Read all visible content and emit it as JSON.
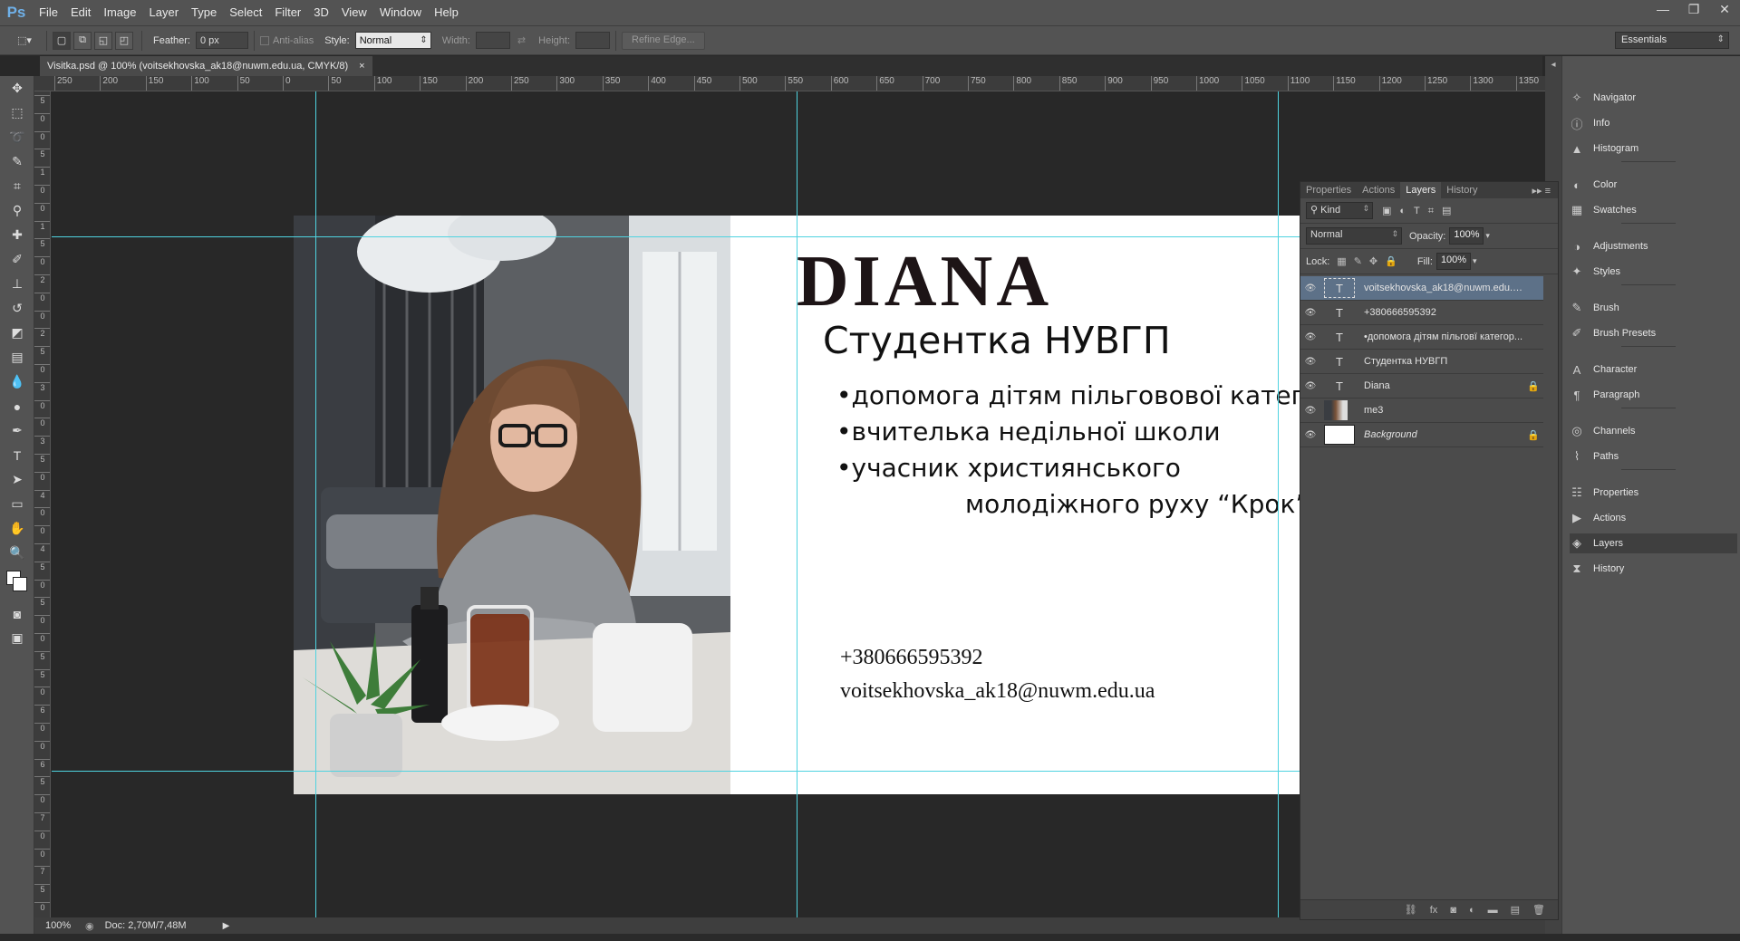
{
  "app": {
    "logo": "Ps"
  },
  "menu": [
    "File",
    "Edit",
    "Image",
    "Layer",
    "Type",
    "Select",
    "Filter",
    "3D",
    "View",
    "Window",
    "Help"
  ],
  "window_controls": [
    "—",
    "❐",
    "✕"
  ],
  "options": {
    "feather_label": "Feather:",
    "feather_value": "0 px",
    "antialias_label": "Anti-alias",
    "style_label": "Style:",
    "style_value": "Normal",
    "width_label": "Width:",
    "height_label": "Height:",
    "refine_edge": "Refine Edge...",
    "workspace": "Essentials"
  },
  "document_tab": {
    "title": "Visitka.psd @ 100% (voitsekhovska_ak18@nuwm.edu.ua, CMYK/8)",
    "close": "×"
  },
  "ruler_h": [
    "250",
    "200",
    "150",
    "100",
    "50",
    "0",
    "50",
    "100",
    "150",
    "200",
    "250",
    "300",
    "350",
    "400",
    "450",
    "500",
    "550",
    "600",
    "650",
    "700",
    "750",
    "800",
    "850",
    "900",
    "950",
    "1000",
    "1050",
    "1100",
    "1150",
    "1200",
    "1250",
    "1300",
    "1350"
  ],
  "ruler_v": [
    "5",
    "0",
    "0",
    "5",
    "1",
    "0",
    "0",
    "1",
    "5",
    "0",
    "2",
    "0",
    "0",
    "2",
    "5",
    "0",
    "3",
    "0",
    "0",
    "3",
    "5",
    "0",
    "4",
    "0",
    "0",
    "4",
    "5",
    "0",
    "5",
    "0",
    "0",
    "5",
    "5",
    "0",
    "6",
    "0",
    "0",
    "6",
    "5",
    "0",
    "7",
    "0",
    "0",
    "7",
    "5",
    "0"
  ],
  "card": {
    "name": "DIANA",
    "subtitle": "Студентка НУВГП",
    "bullets": [
      "•допомога дітям пільговової категорії",
      "•вчителька недільної школи",
      "•учасник християнського"
    ],
    "bullet_continuation": "молодіжного руху “Крок”",
    "phone": "+380666595392",
    "email": "voitsekhovska_ak18@nuwm.edu.ua"
  },
  "status": {
    "zoom": "100%",
    "doc": "Doc: 2,70M/7,48M"
  },
  "panels_dock": [
    {
      "label": "Navigator",
      "icon": "navigator-icon",
      "glyph": "✧"
    },
    {
      "label": "Info",
      "icon": "info-icon",
      "glyph": "ⓘ"
    },
    {
      "label": "Histogram",
      "icon": "histogram-icon",
      "glyph": "▲"
    },
    {
      "label": "Color",
      "icon": "color-icon",
      "glyph": "◐"
    },
    {
      "label": "Swatches",
      "icon": "swatches-icon",
      "glyph": "▦"
    },
    {
      "label": "Adjustments",
      "icon": "adjustments-icon",
      "glyph": "◑"
    },
    {
      "label": "Styles",
      "icon": "styles-icon",
      "glyph": "✦"
    },
    {
      "label": "Brush",
      "icon": "brush-icon",
      "glyph": "✎"
    },
    {
      "label": "Brush Presets",
      "icon": "brush-presets-icon",
      "glyph": "✐"
    },
    {
      "label": "Character",
      "icon": "character-icon",
      "glyph": "A"
    },
    {
      "label": "Paragraph",
      "icon": "paragraph-icon",
      "glyph": "¶"
    },
    {
      "label": "Channels",
      "icon": "channels-icon",
      "glyph": "◎"
    },
    {
      "label": "Paths",
      "icon": "paths-icon",
      "glyph": "⌇"
    },
    {
      "label": "Properties",
      "icon": "properties-icon",
      "glyph": "☷"
    },
    {
      "label": "Actions",
      "icon": "actions-icon",
      "glyph": "▶"
    },
    {
      "label": "Layers",
      "icon": "layers-icon",
      "glyph": "◈"
    },
    {
      "label": "History",
      "icon": "history-icon",
      "glyph": "⧗"
    }
  ],
  "layers_panel": {
    "tabs": [
      "Properties",
      "Actions",
      "Layers",
      "History"
    ],
    "kind_label": "Kind",
    "blend_mode": "Normal",
    "opacity_label": "Opacity:",
    "opacity_value": "100%",
    "lock_label": "Lock:",
    "fill_label": "Fill:",
    "fill_value": "100%",
    "layers": [
      {
        "name": "voitsekhovska_ak18@nuwm.edu.ua",
        "type": "text",
        "selected": true,
        "locked": false
      },
      {
        "name": "+380666595392",
        "type": "text",
        "selected": false,
        "locked": false
      },
      {
        "name": "•допомога дітям пільговї категор...",
        "type": "text",
        "selected": false,
        "locked": false
      },
      {
        "name": "Студентка НУВГП",
        "type": "text",
        "selected": false,
        "locked": false
      },
      {
        "name": "Diana",
        "type": "text",
        "selected": false,
        "locked": true
      },
      {
        "name": "me3",
        "type": "image",
        "selected": false,
        "locked": false
      },
      {
        "name": "Background",
        "type": "fill",
        "selected": false,
        "locked": true
      }
    ]
  }
}
